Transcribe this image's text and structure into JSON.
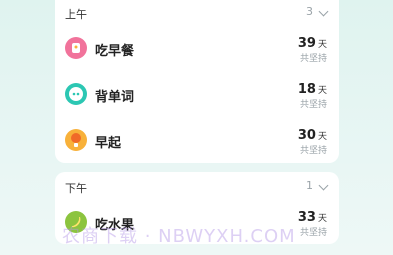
{
  "sections": [
    {
      "title": "上午",
      "count": "3",
      "items": [
        {
          "name": "吃早餐",
          "days": "39",
          "unit": "天",
          "streak_label": "共坚持"
        },
        {
          "name": "背单词",
          "days": "18",
          "unit": "天",
          "streak_label": "共坚持"
        },
        {
          "name": "早起",
          "days": "30",
          "unit": "天",
          "streak_label": "共坚持"
        }
      ]
    },
    {
      "title": "下午",
      "count": "1",
      "items": [
        {
          "name": "吃水果",
          "days": "33",
          "unit": "天",
          "streak_label": "共坚持"
        }
      ]
    }
  ],
  "icons": {
    "breakfast": "bread-icon",
    "words": "quote-icon",
    "early": "sun-icon",
    "fruit": "banana-icon"
  },
  "colors": {
    "pink": "#f1739b",
    "teal": "#2cc7b3",
    "orange": "#f8b13a",
    "green": "#8cc43f"
  },
  "watermark": "农商下载 · NBWYXH.COM"
}
